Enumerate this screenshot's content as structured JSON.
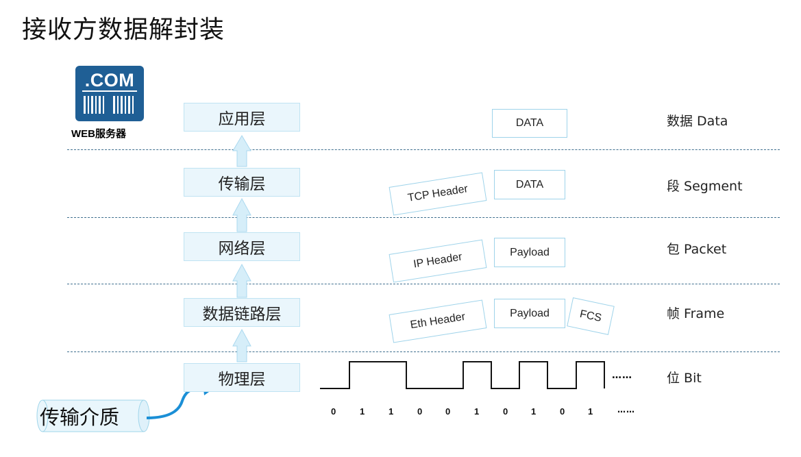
{
  "title": "接收方数据解封装",
  "server": {
    "icon_text": ".COM",
    "label": "WEB服务器"
  },
  "layers": [
    {
      "label": "应用层",
      "unit": "数据 Data"
    },
    {
      "label": "传输层",
      "unit": "段 Segment"
    },
    {
      "label": "网络层",
      "unit": "包 Packet"
    },
    {
      "label": "数据链路层",
      "unit": "帧 Frame"
    },
    {
      "label": "物理层",
      "unit": "位 Bit"
    }
  ],
  "pdus": {
    "app_data": "DATA",
    "tcp_header": "TCP Header",
    "tcp_data": "DATA",
    "ip_header": "IP Header",
    "ip_payload": "Payload",
    "eth_header": "Eth Header",
    "eth_payload": "Payload",
    "fcs": "FCS"
  },
  "signal": {
    "bits": [
      "0",
      "1",
      "1",
      "0",
      "0",
      "1",
      "0",
      "1",
      "0",
      "1"
    ],
    "ellipsis_wave": "……",
    "ellipsis_bits": "……"
  },
  "medium": "传输介质",
  "colors": {
    "accent": "#1f5f95",
    "layer_fill": "#eaf6fc",
    "arrow": "#a9d8ef",
    "curve": "#1b8fd6"
  }
}
